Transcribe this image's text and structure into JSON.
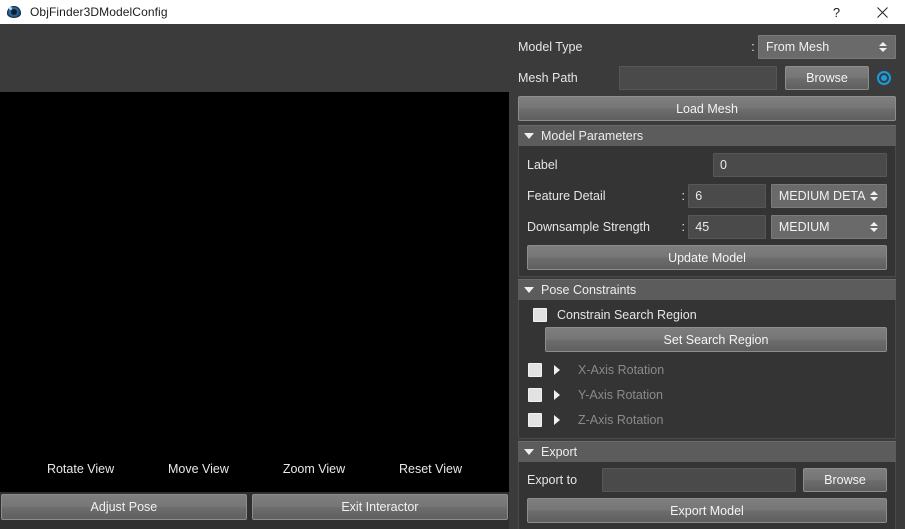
{
  "window": {
    "title": "ObjFinder3DModelConfig",
    "icon": "app-eye-icon",
    "help_label": "?",
    "close_label": "✕"
  },
  "viewport": {
    "tools": [
      {
        "label": "Rotate View",
        "name": "rotate-view"
      },
      {
        "label": "Move View",
        "name": "move-view"
      },
      {
        "label": "Zoom View",
        "name": "zoom-view"
      },
      {
        "label": "Reset View",
        "name": "reset-view"
      }
    ],
    "buttons": [
      {
        "label": "Adjust Pose",
        "name": "adjust-pose"
      },
      {
        "label": "Exit Interactor",
        "name": "exit-interactor"
      }
    ]
  },
  "model_type": {
    "label": "Model Type",
    "separator": ":",
    "value": "From Mesh",
    "options": [
      "From Mesh"
    ]
  },
  "mesh_path": {
    "label": "Mesh Path",
    "value": "",
    "placeholder": "",
    "browse_label": "Browse",
    "indicator_color": "#1a9be0"
  },
  "load_mesh": {
    "label": "Load Mesh"
  },
  "model_parameters": {
    "title": "Model Parameters",
    "expanded": true,
    "label_field": {
      "label": "Label",
      "value": "0"
    },
    "feature_detail": {
      "label": "Feature Detail",
      "separator": ":",
      "value": "6",
      "preset": "MEDIUM DETA",
      "options": [
        "MEDIUM DETA"
      ]
    },
    "downsample_strength": {
      "label": "Downsample Strength",
      "separator": ":",
      "value": "45",
      "preset": "MEDIUM",
      "options": [
        "MEDIUM"
      ]
    },
    "update_button": {
      "label": "Update Model"
    }
  },
  "pose_constraints": {
    "title": "Pose Constraints",
    "expanded": true,
    "constrain_search_region": {
      "label": "Constrain Search Region",
      "checked": false
    },
    "set_search_region_button": {
      "label": "Set Search Region"
    },
    "axes": [
      {
        "label": "X-Axis Rotation",
        "checked": false,
        "enabled": false,
        "expanded": false
      },
      {
        "label": "Y-Axis Rotation",
        "checked": false,
        "enabled": false,
        "expanded": false
      },
      {
        "label": "Z-Axis Rotation",
        "checked": false,
        "enabled": false,
        "expanded": false
      }
    ]
  },
  "export": {
    "title": "Export",
    "expanded": true,
    "export_to": {
      "label": "Export to",
      "value": "",
      "placeholder": "",
      "browse_label": "Browse"
    },
    "export_button": {
      "label": "Export Model"
    }
  },
  "colors": {
    "panel_bg": "#3b3b3b",
    "group_header": "#5c5c5c",
    "group_body": "#343434",
    "field_bg": "#4a4a4a",
    "combo_bg": "#6a6a6a",
    "accent": "#1a9be0",
    "viewport_bg": "#000000",
    "text": "#e6e6e6",
    "text_disabled": "#8a8a8a"
  }
}
